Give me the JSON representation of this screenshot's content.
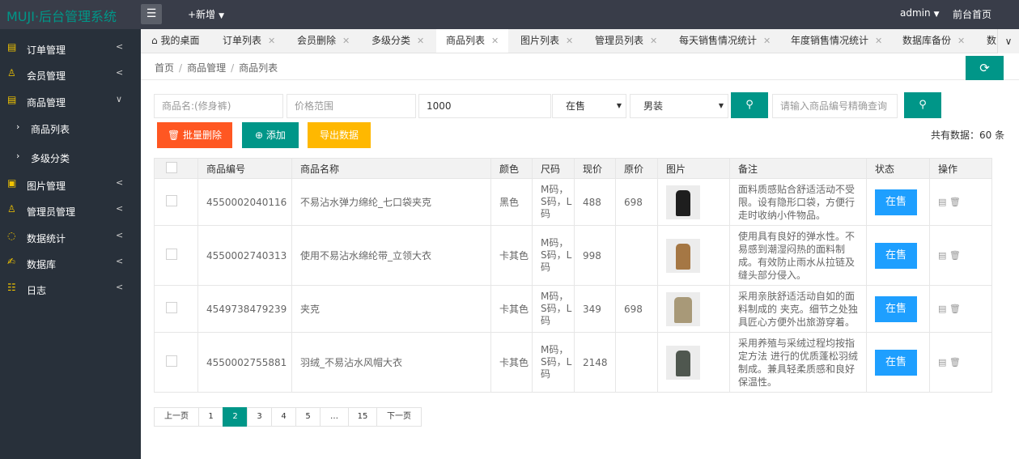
{
  "header": {
    "logo": "MUJI·后台管理系统",
    "new_label": "+新增",
    "user": "admin",
    "front_link": "前台首页"
  },
  "sidebar": {
    "items": [
      {
        "label": "订单管理",
        "icon": "clipboard-icon"
      },
      {
        "label": "会员管理",
        "icon": "user-icon"
      },
      {
        "label": "商品管理",
        "icon": "clipboard-icon"
      },
      {
        "label": "商品列表",
        "icon": "chevron-right-icon"
      },
      {
        "label": "多级分类",
        "icon": "chevron-right-icon"
      },
      {
        "label": "图片管理",
        "icon": "gift-icon"
      },
      {
        "label": "管理员管理",
        "icon": "user-icon"
      },
      {
        "label": "数据统计",
        "icon": "chart-icon"
      },
      {
        "label": "数据库",
        "icon": "database-icon"
      },
      {
        "label": "日志",
        "icon": "log-icon"
      }
    ]
  },
  "tabs": [
    {
      "label": "我的桌面"
    },
    {
      "label": "订单列表"
    },
    {
      "label": "会员删除"
    },
    {
      "label": "多级分类"
    },
    {
      "label": "商品列表"
    },
    {
      "label": "图片列表"
    },
    {
      "label": "管理员列表"
    },
    {
      "label": "每天销售情况统计"
    },
    {
      "label": "年度销售情况统计"
    },
    {
      "label": "数据库备份"
    },
    {
      "label": "数"
    }
  ],
  "breadcrumb": {
    "home": "首页",
    "section": "商品管理",
    "page": "商品列表",
    "sep": "/"
  },
  "filters": {
    "name_placeholder": "商品名:(修身裤)",
    "price_placeholder": "价格范围",
    "price_value": "1000",
    "status_value": "在售",
    "category_value": "男装",
    "code_placeholder": "请输入商品编号精确查询"
  },
  "toolbar": {
    "batch_delete": "批量删除",
    "add": "添加",
    "export": "导出数据",
    "total": "共有数据：60 条"
  },
  "table": {
    "headers": [
      "商品编号",
      "商品名称",
      "颜色",
      "尺码",
      "现价",
      "原价",
      "图片",
      "备注",
      "状态",
      "操作"
    ],
    "rows": [
      {
        "code": "4550002040116",
        "name": "不易沾水弹力绵纶_七口袋夹克",
        "color": "黑色",
        "size": "M码，S码，L码",
        "price": "488",
        "orig": "698",
        "note": "面料质感贴合舒适活动不受限。设有隐形口袋，方便行走时收纳小件物品。",
        "status": "在售"
      },
      {
        "code": "4550002740313",
        "name": "使用不易沾水绵纶带_立领大衣",
        "color": "卡其色",
        "size": "M码，S码，L码",
        "price": "998",
        "orig": "",
        "note": "使用具有良好的弹水性。不易感到潮湿闷热的面料制成。有效防止雨水从拉链及缝头部分侵入。",
        "status": "在售"
      },
      {
        "code": "4549738479239",
        "name": "夹克",
        "color": "卡其色",
        "size": "M码，S码，L码",
        "price": "349",
        "orig": "698",
        "note": "采用亲肤舒适活动自如的面料制成的 夹克。细节之处独具匠心方便外出旅游穿着。",
        "status": "在售"
      },
      {
        "code": "4550002755881",
        "name": "羽绒_不易沾水风帽大衣",
        "color": "卡其色",
        "size": "M码，S码，L码",
        "price": "2148",
        "orig": "",
        "note": "采用养殖与采绒过程均按指定方法 进行的优质蓬松羽绒制成。兼具轻柔质感和良好保温性。",
        "status": "在售"
      }
    ]
  },
  "pager": {
    "prev": "上一页",
    "p1": "1",
    "p2": "2",
    "p3": "3",
    "p4": "4",
    "p5": "5",
    "dots": "…",
    "last": "15",
    "next": "下一页"
  }
}
